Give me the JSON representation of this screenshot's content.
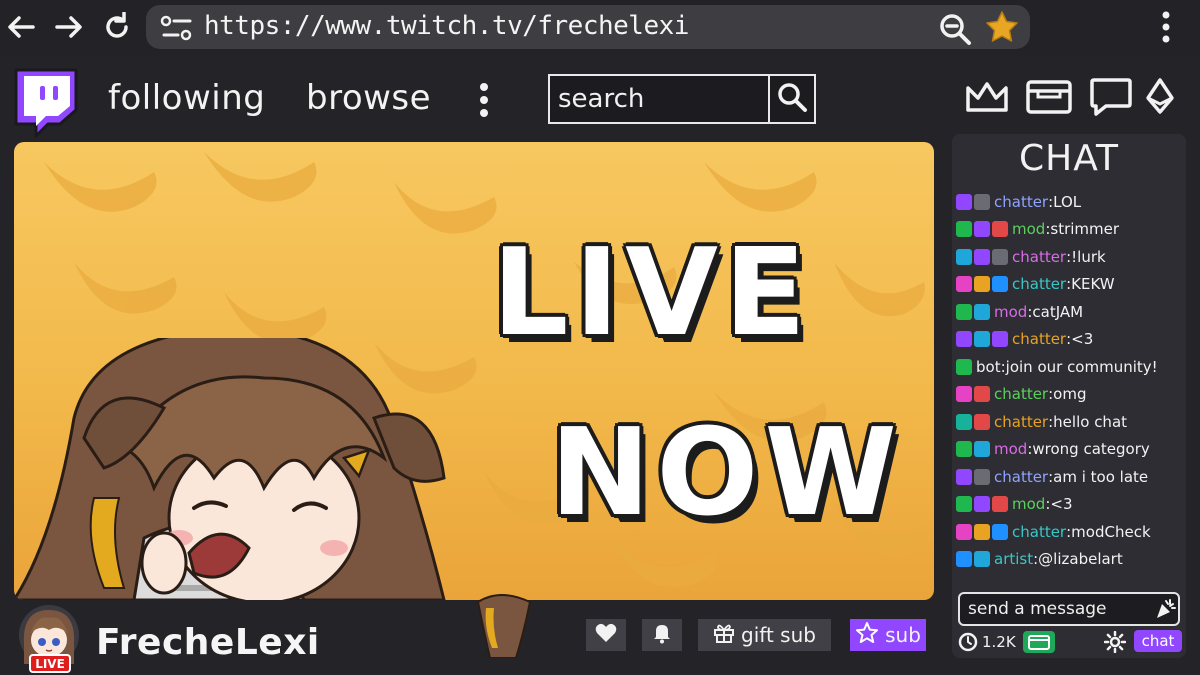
{
  "browser": {
    "url": "https://www.twitch.tv/frechelexi",
    "icons": [
      "back-arrow-icon",
      "forward-arrow-icon",
      "reload-icon",
      "site-settings-icon",
      "zoom-out-icon",
      "bookmark-star-icon",
      "browser-menu-icon"
    ],
    "star_color": "#e7a623"
  },
  "header": {
    "nav": {
      "following": "following",
      "browse": "browse"
    },
    "search": {
      "placeholder": "search"
    },
    "icons": [
      "crown-icon",
      "inbox-icon",
      "whispers-icon",
      "bits-icon"
    ],
    "brand_color": "#9147ff"
  },
  "stream": {
    "overlay_line1": "LIVE",
    "overlay_line2": "NOW",
    "background_color": "#f2b84a"
  },
  "channel": {
    "name": "FrecheLexi",
    "live_badge": "LIVE",
    "actions": {
      "gift": "gift sub",
      "sub": "sub"
    }
  },
  "chat": {
    "title": "CHAT",
    "messages": [
      {
        "user": "chatter",
        "text": "LOL",
        "color": "#8fa3ff",
        "badges": [
          "#9147ff",
          "#6b6b73"
        ]
      },
      {
        "user": "mod",
        "text": "strimmer",
        "color": "#5bd15b",
        "badges": [
          "#1fb84f",
          "#9147ff",
          "#e34848"
        ]
      },
      {
        "user": "chatter",
        "text": "!lurk",
        "color": "#d86ce6",
        "badges": [
          "#1ea7d8",
          "#9147ff",
          "#6b6b73"
        ]
      },
      {
        "user": "chatter",
        "text": "KEKW",
        "color": "#38c7c7",
        "badges": [
          "#e642c4",
          "#e8a323",
          "#1e90ff"
        ]
      },
      {
        "user": "mod",
        "text": "catJAM",
        "color": "#d86ce6",
        "badges": [
          "#1fb84f",
          "#1ea7d8"
        ]
      },
      {
        "user": "chatter",
        "text": "<3",
        "color": "#e8a323",
        "badges": [
          "#9147ff",
          "#1ea7d8",
          "#9147ff"
        ]
      },
      {
        "user": "bot",
        "text": "join our community!",
        "color": "#f2f2f2",
        "badges": [
          "#1fb84f"
        ]
      },
      {
        "user": "chatter",
        "text": "omg",
        "color": "#5bd15b",
        "badges": [
          "#e642c4",
          "#e34848"
        ]
      },
      {
        "user": "chatter",
        "text": "hello chat",
        "color": "#e8a323",
        "badges": [
          "#16b39a",
          "#e34848"
        ]
      },
      {
        "user": "mod",
        "text": "wrong category",
        "color": "#d86ce6",
        "badges": [
          "#1fb84f",
          "#1ea7d8"
        ]
      },
      {
        "user": "chatter",
        "text": "am i too late",
        "color": "#8fa3ff",
        "badges": [
          "#9147ff",
          "#6b6b73"
        ]
      },
      {
        "user": "mod",
        "text": "<3",
        "color": "#5bd15b",
        "badges": [
          "#1fb84f",
          "#9147ff",
          "#e34848"
        ]
      },
      {
        "user": "chatter",
        "text": "modCheck",
        "color": "#38c7c7",
        "badges": [
          "#e642c4",
          "#e8a323",
          "#1e90ff"
        ]
      },
      {
        "user": "artist",
        "text": "@lizabelart",
        "color": "#38c7c7",
        "badges": [
          "#1e90ff",
          "#1ea7d8"
        ]
      }
    ],
    "input_placeholder": "send a message",
    "viewer_count": "1.2K",
    "chat_button": "chat"
  }
}
